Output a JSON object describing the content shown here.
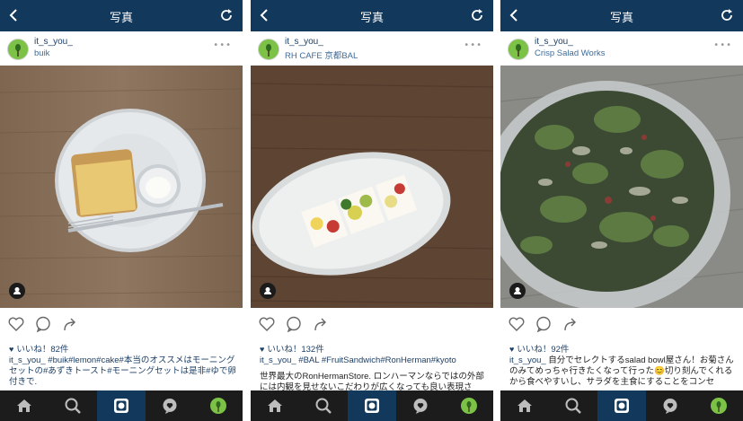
{
  "screen_title": "写真",
  "posts": [
    {
      "username": "it_s_you_",
      "location": "buik",
      "likes": "いいね！82件",
      "caption_user": "it_s_you_",
      "caption_text": " #buik#lemon#cake#本当のオススメはモーニングセットの#あずきトースト#モーニングセットは是非#ゆで卵 付きで."
    },
    {
      "username": "it_s_you_",
      "location": "RH CAFE 京都BAL",
      "likes": "いいね！132件",
      "caption_user": "it_s_you_",
      "caption_text": " #BAL #FruitSandwich#RonHerman#kyoto",
      "caption_more": "世界最大のRonHermanStore. ロンハーマンならではの外部には内観を見せないこだわりが広くなっても良い表現さ"
    },
    {
      "username": "it_s_you_",
      "location": "Crisp Salad Works",
      "likes": "いいね！92件",
      "caption_user": "it_s_you_",
      "caption_text": " 自分でセレクトするsalad bowl屋さん！お菊さんのみてめっちゃ行きたくなって行った😊切り刻んでくれるから食べやすいし、サラダを主食にすることをコンセ"
    }
  ],
  "icons": {
    "back": "chevron-left-icon",
    "refresh": "refresh-icon",
    "more": "more-dots-icon",
    "like": "heart-icon",
    "comment": "comment-icon",
    "share": "share-icon",
    "tabs": [
      "home-icon",
      "search-icon",
      "camera-icon",
      "activity-icon",
      "profile-icon"
    ]
  },
  "colors": {
    "topbar": "#12395c",
    "link": "#1c3f66",
    "tabbar": "#1c1c1c"
  }
}
